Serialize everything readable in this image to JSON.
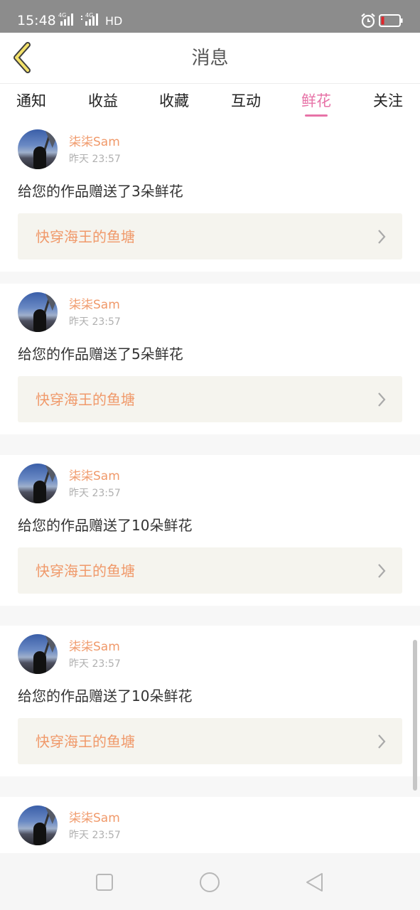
{
  "status_bar": {
    "time": "15:48",
    "network_1": "4G",
    "network_2": "4G",
    "hd": "HD",
    "battery_color": "#e0242a"
  },
  "header": {
    "back_icon": "chevron-left-icon",
    "title": "消息"
  },
  "tabs": {
    "items": [
      {
        "label": "通知"
      },
      {
        "label": "收益"
      },
      {
        "label": "收藏"
      },
      {
        "label": "互动"
      },
      {
        "label": "鲜花",
        "active": true
      },
      {
        "label": "关注"
      }
    ],
    "accent_color": "#e773a7"
  },
  "messages": [
    {
      "user": "柒柒Sam",
      "time": "昨天 23:57",
      "text": "给您的作品赠送了3朵鲜花",
      "work": "快穿海王的鱼塘"
    },
    {
      "user": "柒柒Sam",
      "time": "昨天 23:57",
      "text": "给您的作品赠送了5朵鲜花",
      "work": "快穿海王的鱼塘"
    },
    {
      "user": "柒柒Sam",
      "time": "昨天 23:57",
      "text": "给您的作品赠送了10朵鲜花",
      "work": "快穿海王的鱼塘"
    },
    {
      "user": "柒柒Sam",
      "time": "昨天 23:57",
      "text": "给您的作品赠送了10朵鲜花",
      "work": "快穿海王的鱼塘"
    },
    {
      "user": "柒柒Sam",
      "time": "昨天 23:57"
    }
  ],
  "colors": {
    "name": "#f0996a",
    "work_link_bg": "#f5f4ee"
  },
  "nav_bar": {
    "icons": [
      "square-icon",
      "circle-icon",
      "triangle-back-icon"
    ]
  }
}
